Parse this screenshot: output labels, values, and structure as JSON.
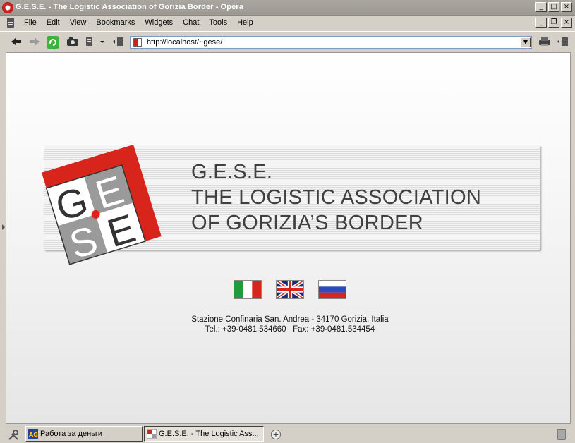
{
  "window": {
    "title": "G.E.S.E. - The Logistic Association of Gorizia Border - Opera",
    "buttons": [
      "_",
      "□",
      "×"
    ]
  },
  "menu": {
    "items": [
      "File",
      "Edit",
      "View",
      "Bookmarks",
      "Widgets",
      "Chat",
      "Tools",
      "Help"
    ],
    "doc_buttons": [
      "_",
      "❐",
      "×"
    ]
  },
  "toolbar": {
    "url": "http://localhost/~gese/",
    "icons": [
      "back-icon",
      "forward-icon",
      "reload-icon",
      "snapshot-icon",
      "page-icon",
      "dropdown-icon",
      "panel-icon",
      "print-icon",
      "panel-right-icon"
    ]
  },
  "page": {
    "logo_letters": [
      "G",
      "E",
      "S",
      "E"
    ],
    "headline": [
      "G.E.S.E.",
      "THE LOGISTIC ASSOCIATION",
      "OF GORIZIA’S BORDER"
    ],
    "flags": [
      "italy-flag",
      "uk-flag",
      "russia-flag"
    ],
    "contact_line1": "Stazione Confinaria San. Andrea - 34170 Gorizia. Italia",
    "contact_line2": "Tel.: +39-0481.534660   Fax: +39-0481.534454",
    "colors": {
      "brand_red": "#d8251c",
      "logo_gray": "#9a9a9a",
      "text": "#404040"
    }
  },
  "taskbar": {
    "tab1": "Работа за деньги",
    "tab1_icon_text": "AG",
    "tab2": "G.E.S.E. - The Logistic Ass...",
    "add_tab": "+"
  }
}
